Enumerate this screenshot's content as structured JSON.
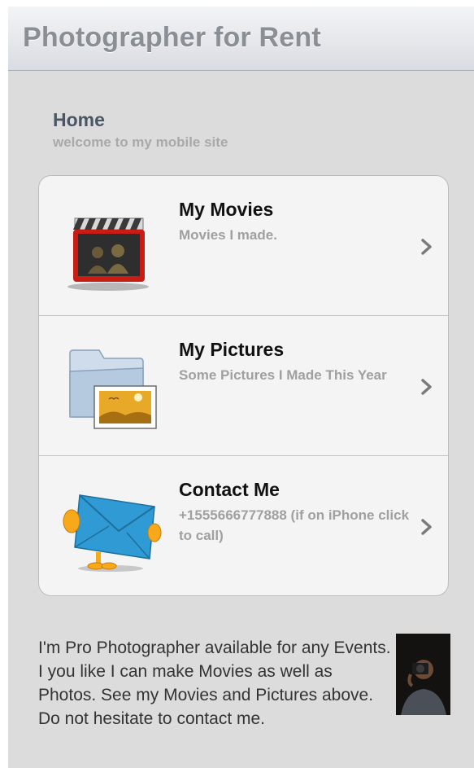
{
  "header": {
    "title": "Photographer for Rent"
  },
  "home": {
    "title": "Home",
    "subtitle": "welcome to my mobile site"
  },
  "menu": {
    "items": [
      {
        "title": "My Movies",
        "description": "Movies I made.",
        "icon": "movie-clapper-icon"
      },
      {
        "title": "My Pictures",
        "description": "Some Pictures I Made This Year",
        "icon": "pictures-folder-icon"
      },
      {
        "title": "Contact Me",
        "description": "+1555666777888 (if on iPhone click to call)",
        "icon": "envelope-icon"
      }
    ]
  },
  "bio": {
    "text": "I'm Pro Photographer available for any Events. I you like I can make Movies as well as Photos. See my Movies and Pictures above. Do not hesitate to contact me."
  },
  "colors": {
    "page_background": "#dcdcdc",
    "header_text": "#8a8f96",
    "home_title": "#4a5566",
    "list_background": "#f4f4f4"
  }
}
